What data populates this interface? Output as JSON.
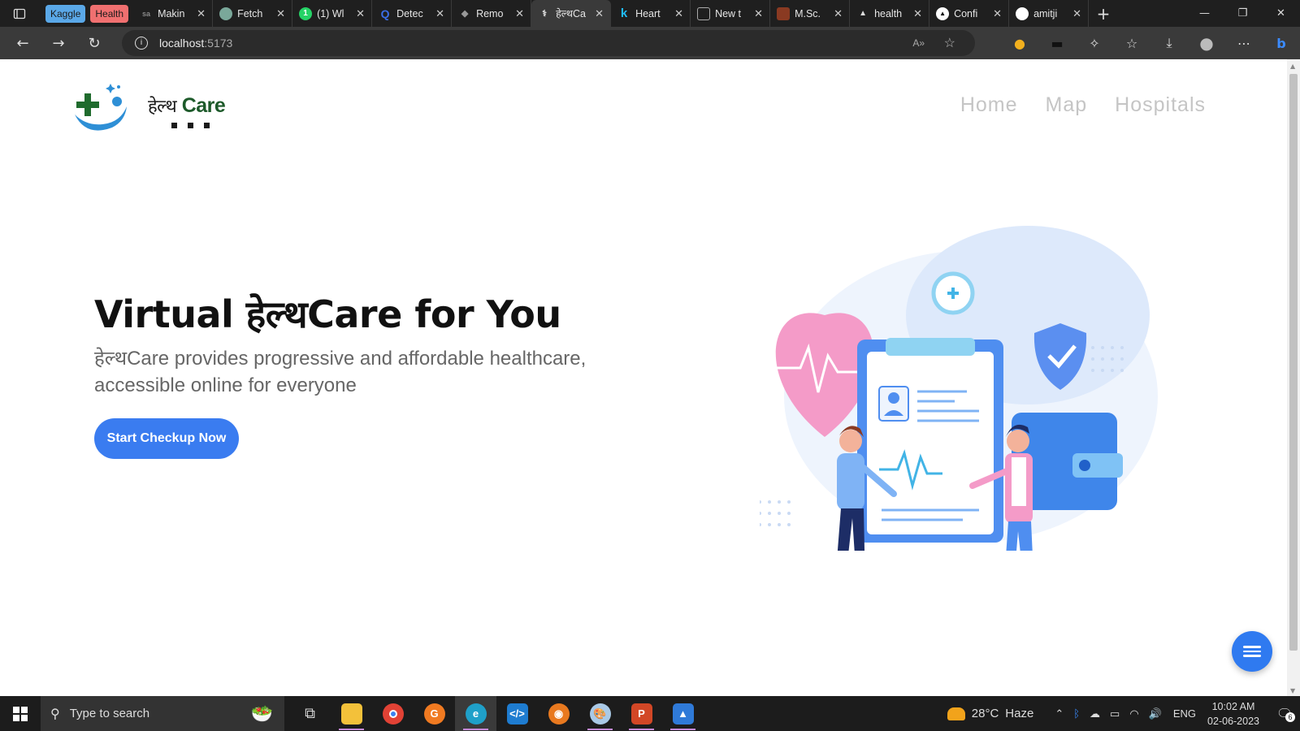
{
  "browser": {
    "tab_groups": [
      {
        "label": "Kaggle",
        "color": "#5aa8e8"
      },
      {
        "label": "Health",
        "color": "#f07070"
      }
    ],
    "tabs": [
      {
        "title": "Makin",
        "icon": "sa-icon",
        "active": false
      },
      {
        "title": "Fetch",
        "icon": "openai-icon",
        "active": false
      },
      {
        "title": "(1) Wl",
        "icon": "whatsapp-icon",
        "active": false
      },
      {
        "title": "Detec",
        "icon": "search-engine-icon",
        "active": false
      },
      {
        "title": "Remo",
        "icon": "bird-icon",
        "active": false
      },
      {
        "title": "हेल्थCa",
        "icon": "doctor-icon",
        "active": true
      },
      {
        "title": "Heart",
        "icon": "k-icon",
        "active": false
      },
      {
        "title": "New t",
        "icon": "page-icon",
        "active": false
      },
      {
        "title": "M.Sc.",
        "icon": "university-icon",
        "active": false
      },
      {
        "title": "health",
        "icon": "triangle-icon",
        "active": false
      },
      {
        "title": "Confi",
        "icon": "vercel-icon",
        "active": false
      },
      {
        "title": "amitji",
        "icon": "github-icon",
        "active": false
      }
    ],
    "url_host": "localhost",
    "url_port": ":5173",
    "read_aloud": "A»"
  },
  "site": {
    "logo_devanagari": "हेल्थ",
    "logo_latin": "Care",
    "nav": [
      "Home",
      "Map",
      "Hospitals"
    ],
    "hero_title": "Virtual हेल्थCare for You",
    "hero_subtitle": "हेल्थCare provides progressive and affordable healthcare, accessible online for everyone",
    "cta_label": "Start Checkup Now",
    "accent_color": "#3a7cf0"
  },
  "taskbar": {
    "search_placeholder": "Type to search",
    "apps": [
      "task-view-icon",
      "file-explorer-icon",
      "chrome-icon",
      "grammarly-icon",
      "edge-icon",
      "vscode-icon",
      "blender-icon",
      "paint-icon",
      "powerpoint-icon",
      "photos-icon"
    ],
    "weather_temp": "28°C",
    "weather_desc": "Haze",
    "language": "ENG",
    "time": "10:02 AM",
    "date": "02-06-2023",
    "notification_count": "6"
  }
}
